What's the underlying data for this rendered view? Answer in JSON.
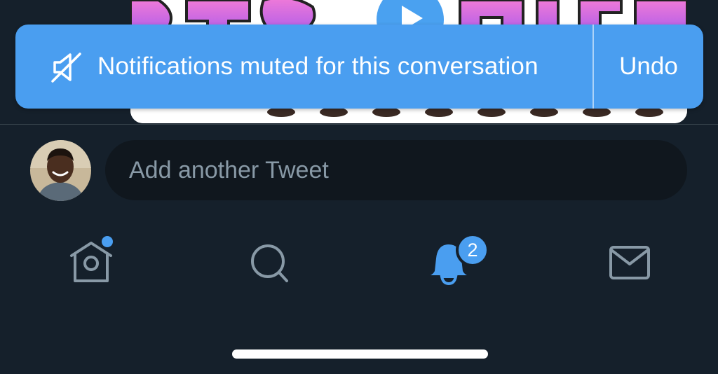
{
  "toast": {
    "message": "Notifications muted for this conversation",
    "action_label": "Undo",
    "icon": "muted-speaker-icon"
  },
  "reply": {
    "placeholder": "Add another Tweet",
    "avatar_icon": "user-avatar"
  },
  "tabbar": {
    "items": [
      {
        "name": "home",
        "icon": "home-icon",
        "has_new_dot": true
      },
      {
        "name": "search",
        "icon": "search-icon"
      },
      {
        "name": "notifications",
        "icon": "bell-icon",
        "active": true,
        "badge": "2"
      },
      {
        "name": "messages",
        "icon": "mail-icon"
      }
    ]
  },
  "colors": {
    "background": "#15202b",
    "accent": "#4a9ef0",
    "icon_inactive": "#8899a6",
    "input_background": "#10171e"
  }
}
